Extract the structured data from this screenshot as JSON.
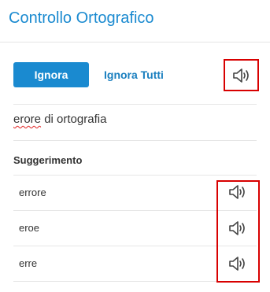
{
  "header": {
    "title": "Controllo Ortografico"
  },
  "actions": {
    "ignore_label": "Ignora",
    "ignore_all_label": "Ignora Tutti"
  },
  "misspelled": {
    "prefix": "erore",
    "suffix": " di ortografia"
  },
  "suggestions": {
    "heading": "Suggerimento",
    "items": [
      {
        "label": "errore"
      },
      {
        "label": "eroe"
      },
      {
        "label": "erre"
      }
    ]
  },
  "icons": {
    "speaker": "speaker-icon"
  },
  "colors": {
    "accent": "#1a8ad0",
    "highlight": "#d80000",
    "spell_error": "#e02020"
  }
}
